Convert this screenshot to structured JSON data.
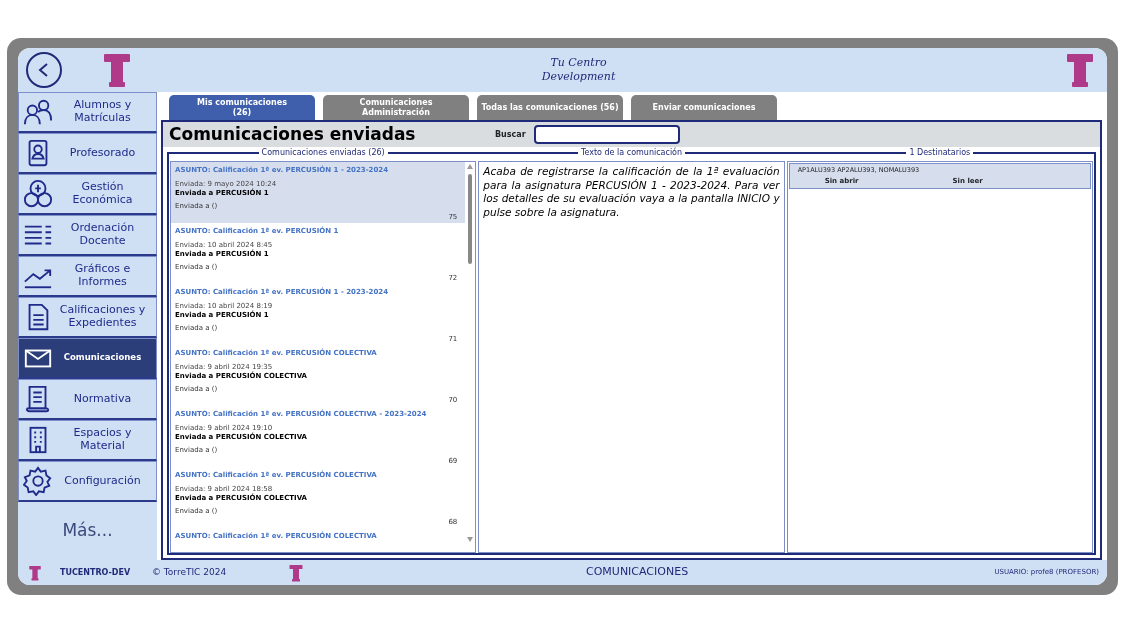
{
  "header": {
    "title_lines": [
      "Tu Centro",
      "Development"
    ]
  },
  "sidebar": {
    "items": [
      {
        "label": "Alumnos y Matrículas",
        "kind": "users",
        "selected": false
      },
      {
        "label": "Profesorado",
        "kind": "teacher",
        "selected": false
      },
      {
        "label": "Gestión Económica",
        "kind": "money",
        "selected": false
      },
      {
        "label": "Ordenación Docente",
        "kind": "list",
        "selected": false
      },
      {
        "label": "Gráficos e Informes",
        "kind": "chart",
        "selected": false
      },
      {
        "label": "Calificaciones y Expedientes",
        "kind": "document",
        "selected": false
      },
      {
        "label": "Comunicaciones",
        "kind": "mail",
        "selected": true
      },
      {
        "label": "Normativa",
        "kind": "scroll",
        "selected": false
      },
      {
        "label": "Espacios y Material",
        "kind": "building",
        "selected": false
      },
      {
        "label": "Configuración",
        "kind": "gear",
        "selected": false
      }
    ],
    "more": "Más..."
  },
  "tabs": [
    {
      "lines": [
        "Mis comunicaciones",
        "(26)"
      ],
      "selected": true
    },
    {
      "lines": [
        "Comunicaciones",
        "Administración"
      ],
      "selected": false
    },
    {
      "lines": [
        "Todas las comunicaciones (56)"
      ],
      "selected": false
    },
    {
      "lines": [
        "Enviar comunicaciones"
      ],
      "selected": false
    }
  ],
  "panel": {
    "title": "Comunicaciones enviadas",
    "search_label": "Buscar"
  },
  "sections": [
    "Comunicaciones enviadas (26)",
    "Texto de la comunicación",
    "1  Destinatarios"
  ],
  "messages": [
    {
      "subject": "ASUNTO: Calificación 1ª ev. PERCUSIÓN 1  -  2023-2024",
      "sent": "Enviada: 9 mayo 2024 10:24",
      "to": "Enviada a PERCUSIÓN 1",
      "detail": "Enviada a ()",
      "number": "75",
      "selected": true
    },
    {
      "subject": "ASUNTO: Calificación 1ª ev. PERCUSIÓN 1",
      "sent": "Enviada: 10 abril 2024 8:45",
      "to": "Enviada a PERCUSIÓN 1",
      "detail": "Enviada a ()",
      "number": "72",
      "selected": false
    },
    {
      "subject": "ASUNTO: Calificación 1ª ev. PERCUSIÓN 1  -  2023-2024",
      "sent": "Enviada: 10 abril 2024 8:19",
      "to": "Enviada a PERCUSIÓN 1",
      "detail": "Enviada a ()",
      "number": "71",
      "selected": false
    },
    {
      "subject": "ASUNTO: Calificación 1ª ev. PERCUSIÓN COLECTIVA",
      "sent": "Enviada: 9 abril 2024 19:35",
      "to": "Enviada a PERCUSIÓN COLECTIVA",
      "detail": "Enviada a ()",
      "number": "70",
      "selected": false
    },
    {
      "subject": "ASUNTO: Calificación 1ª ev. PERCUSIÓN COLECTIVA  -  2023-2024",
      "sent": "Enviada: 9 abril 2024 19:10",
      "to": "Enviada a PERCUSIÓN COLECTIVA",
      "detail": "Enviada a ()",
      "number": "69",
      "selected": false
    },
    {
      "subject": "ASUNTO: Calificación 1ª ev. PERCUSIÓN COLECTIVA",
      "sent": "Enviada: 9 abril 2024 18:58",
      "to": "Enviada a PERCUSIÓN COLECTIVA",
      "detail": "Enviada a ()",
      "number": "68",
      "selected": false
    },
    {
      "subject": "ASUNTO: Calificación 1ª ev. PERCUSIÓN COLECTIVA"
    }
  ],
  "message_text": "Acaba de registrarse la calificación de la 1ª evaluación para la asignatura PERCUSIÓN 1  -  2023-2024. Para ver los detalles de su evaluación vaya a la pantalla INICIO y pulse sobre la asignatura.",
  "recipients": [
    {
      "name": "AP1ALU393 AP2ALU393, NOMALU393",
      "opened": "Sin abrir",
      "read": "Sin leer"
    }
  ],
  "footer": {
    "app": "TUCENTRO-DEV",
    "copyright": "© TorreTIC  2024",
    "screen": "COMUNICACIONES",
    "user": "USUARIO: profe8 (PROFESOR)"
  }
}
